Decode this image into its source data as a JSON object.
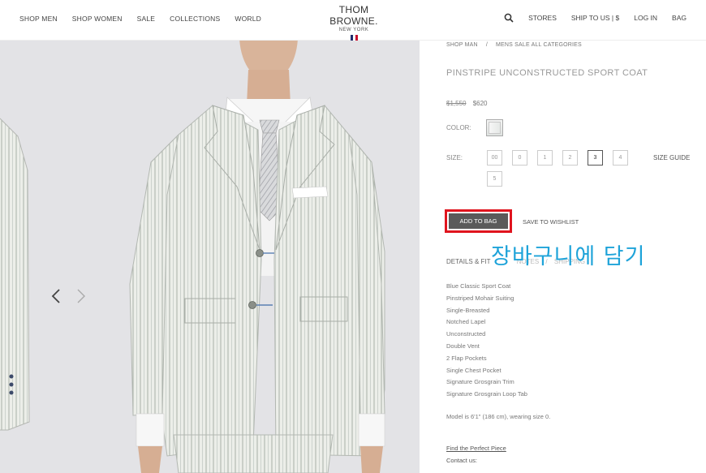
{
  "header": {
    "nav_left": [
      "SHOP MEN",
      "SHOP WOMEN",
      "SALE",
      "COLLECTIONS",
      "WORLD"
    ],
    "logo_main": "THOM BROWNE.",
    "logo_sub": "NEW YORK",
    "nav_right": [
      "STORES",
      "SHIP TO US | $",
      "LOG IN",
      "BAG"
    ],
    "flag_colors": [
      "#1f2b6b",
      "#ffffff",
      "#c8102e"
    ]
  },
  "breadcrumb": {
    "first": "SHOP MAN",
    "separator": "/",
    "second": "MENS SALE ALL CATEGORIES"
  },
  "product": {
    "title": "PINSTRIPE UNCONSTRUCTED SPORT COAT",
    "price_old": "$1,550",
    "price_new": "$620",
    "color_label": "COLOR:",
    "size_label": "SIZE:",
    "sizes": [
      "00",
      "0",
      "1",
      "2",
      "3",
      "4",
      "5"
    ],
    "selected_size": "3",
    "size_guide": "SIZE GUIDE",
    "add_to_bag": "ADD TO BAG",
    "save_wishlist": "SAVE TO WISHLIST"
  },
  "annotation": "장바구니에 담기",
  "tabs": {
    "details": "DETAILS & FIT",
    "notes": "NOTES",
    "separator": "/",
    "shipping": "SHIPPING"
  },
  "details": [
    "Blue Classic Sport Coat",
    "Pinstriped Mohair Suiting",
    "Single-Breasted",
    "Notched Lapel",
    "Unconstructed",
    "Double Vent",
    "2 Flap Pockets",
    "Single Chest Pocket",
    "Signature Grosgrain Trim",
    "Signature Grosgrain Loop Tab"
  ],
  "model_note": "Model is 6'1\" (186 cm), wearing size 0.",
  "find_perfect": "Find the Perfect Piece",
  "contact": "Contact us:",
  "colors": {
    "highlight": "#e0141e",
    "annotation": "#1ea3d9",
    "button": "#5a5a5a"
  }
}
